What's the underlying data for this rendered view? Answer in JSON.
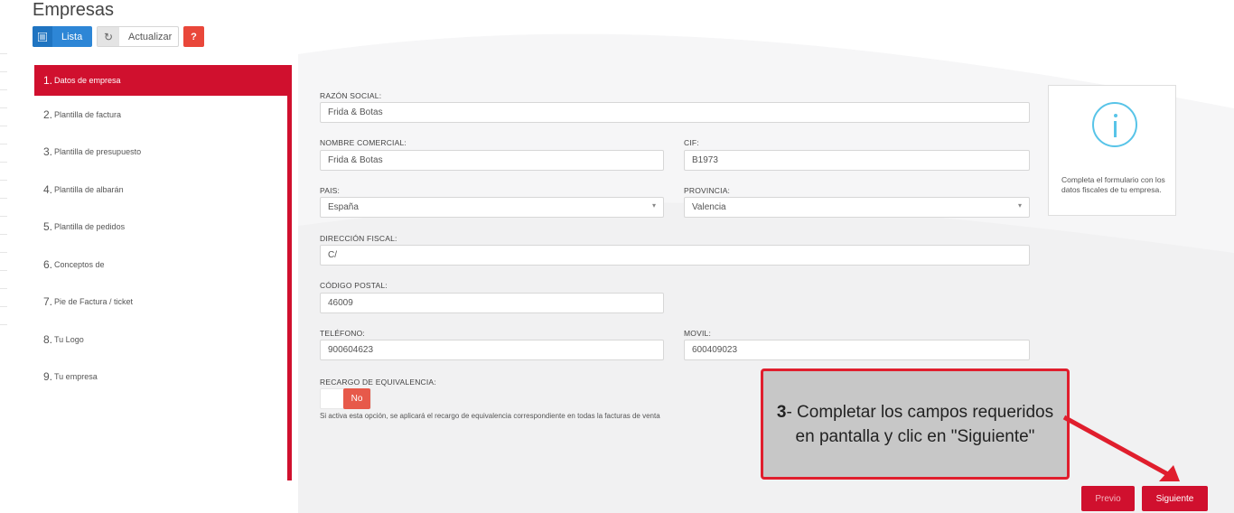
{
  "page": {
    "title": "Empresas"
  },
  "toolbar": {
    "lista_label": "Lista",
    "actualizar_label": "Actualizar",
    "help_label": "?",
    "lista_icon": "list-icon",
    "actualizar_icon": "refresh-icon"
  },
  "sidebar": {
    "items": [
      {
        "num": "1.",
        "label": "Datos de empresa"
      },
      {
        "num": "2.",
        "label": "Plantilla de factura"
      },
      {
        "num": "3.",
        "label": "Plantilla de presupuesto"
      },
      {
        "num": "4.",
        "label": "Plantilla de albarán"
      },
      {
        "num": "5.",
        "label": "Plantilla de pedidos"
      },
      {
        "num": "6.",
        "label": "Conceptos de"
      },
      {
        "num": "7.",
        "label": "Pie de Factura / ticket"
      },
      {
        "num": "8.",
        "label": "Tu Logo"
      },
      {
        "num": "9.",
        "label": "Tu empresa"
      }
    ]
  },
  "form": {
    "razon_social": {
      "label": "RAZÓN SOCIAL:",
      "value": "Frida & Botas"
    },
    "nombre_comercial": {
      "label": "NOMBRE COMERCIAL:",
      "value": "Frida & Botas"
    },
    "cif": {
      "label": "CIF:",
      "value": "B1973"
    },
    "pais": {
      "label": "PAIS:",
      "value": "España"
    },
    "provincia": {
      "label": "PROVINCIA:",
      "value": "Valencia"
    },
    "direccion": {
      "label": "DIRECCIÓN FISCAL:",
      "value": "C/"
    },
    "codigo_postal": {
      "label": "CÓDIGO POSTAL:",
      "value": "46009"
    },
    "telefono": {
      "label": "TELÉFONO:",
      "value": "900604623"
    },
    "movil": {
      "label": "MOVIL:",
      "value": "600409023"
    },
    "recargo": {
      "label": "RECARGO DE EQUIVALENCIA:",
      "toggle_value": "No",
      "hint": "Si activa esta opción, se aplicará el recargo de equivalencia correspondiente en todas la facturas de venta"
    }
  },
  "info": {
    "icon": "info-icon",
    "text": "Completa el formulario con los datos fiscales de tu empresa."
  },
  "callout": {
    "step": "3",
    "text": "- Completar los campos requeridos en pantalla y clic en \"Siguiente\""
  },
  "nav": {
    "prev_label": "Previo",
    "next_label": "Siguiente"
  },
  "colors": {
    "accent": "#d0102e",
    "primary": "#2d86d6",
    "info": "#58c4e8"
  }
}
